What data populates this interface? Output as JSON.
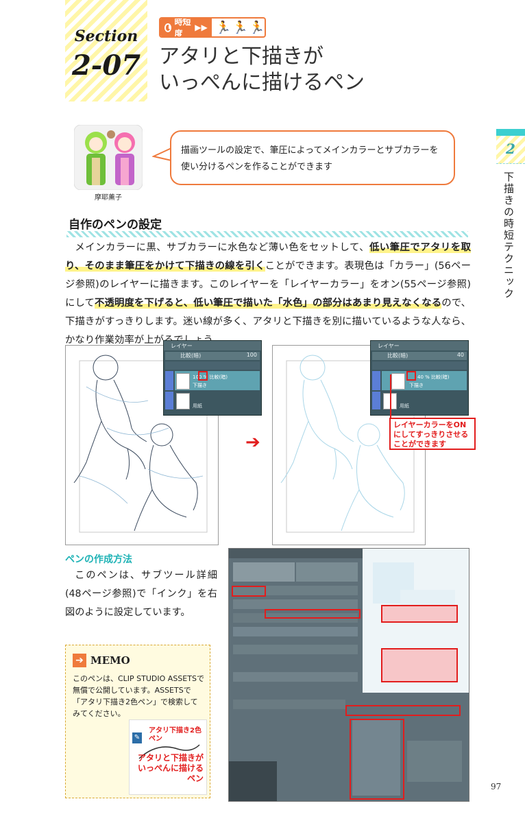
{
  "section": {
    "word": "Section",
    "number": "2-07"
  },
  "time_badge": {
    "label": "時短度"
  },
  "title": {
    "line1": "アタリと下描きが",
    "line2": "いっぺんに描けるペン"
  },
  "side_tab": {
    "number": "2",
    "text": "下描きの時短テクニック"
  },
  "character": {
    "name": "摩耶薫子"
  },
  "bubble": {
    "text": "描画ツールの設定で、筆圧によってメインカラーとサブカラーを使い分けるペンを作ることができます"
  },
  "heading": "自作のペンの設定",
  "body": {
    "p1": "メインカラーに黒、サブカラーに水色など薄い色をセットして、",
    "h1": "低い筆圧でアタリを取り、そのまま筆圧をかけて下描きの線を引く",
    "p2": "ことができます。表現色は「カラー」(56ページ参照)のレイヤーに描きます。このレイヤーを「レイヤーカラー」をオン(55ページ参照)にして",
    "h2": "不透明度を下げると、低い筆圧で描いた「水色」の部分はあまり見えなくなる",
    "p3": "ので、下描きがすっきりします。迷い線が多く、アタリと下描きを別に描いているような人なら、かなり作業効率が上がるでしょう。"
  },
  "layer_panel_left": {
    "tab": "レイヤー",
    "blend": "比較(暗)",
    "opacity": "100",
    "layer_name": "100 % 比較(暗)",
    "layer_sub": "下描き",
    "paper": "用紙"
  },
  "layer_panel_right": {
    "tab": "レイヤー",
    "blend": "比較(暗)",
    "opacity": "40",
    "layer_name": "40 % 比較(暗)",
    "layer_sub": "下描き",
    "paper": "用紙"
  },
  "callout": {
    "text": "レイヤーカラーをONにしてすっきりさせることができます"
  },
  "pen_section": {
    "heading": "ペンの作成方法",
    "text": "このペンは、サブツール詳細(48ページ参照)で「インク」を右図のように設定しています。"
  },
  "memo": {
    "title": "MEMO",
    "text": "このペンは、CLIP STUDIO ASSETSで無償で公開しています。ASSETSで「アタリ下描き2色ペン」で検索してみてください。",
    "asset_title": "アタリ下描き2色ペン",
    "asset_slogan": "アタリと下描きがいっぺんに描けるペン"
  },
  "page_number": "97",
  "colors": {
    "accent_orange": "#ef7a3c",
    "accent_teal": "#3ccfd0",
    "highlight": "#fff38a",
    "callout_red": "#e21d1d"
  }
}
